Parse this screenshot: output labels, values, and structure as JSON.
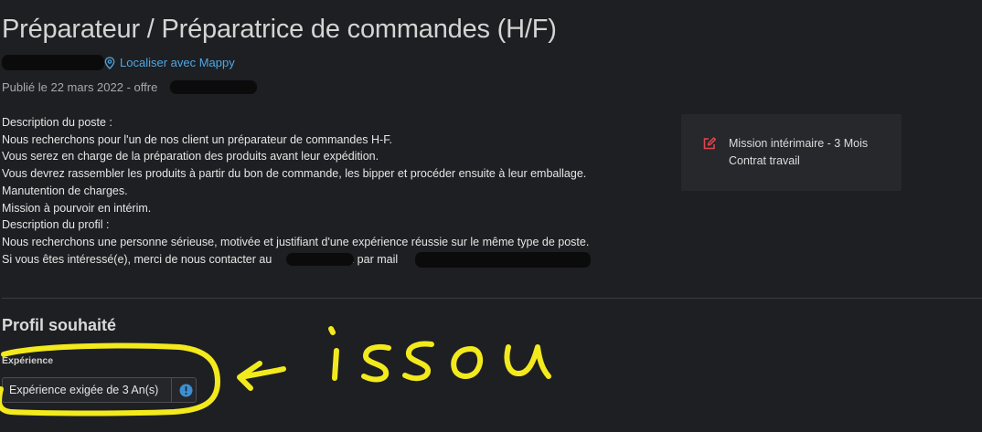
{
  "job": {
    "title": "Préparateur / Préparatrice de commandes (H/F)",
    "mappy_label": "Localiser avec Mappy",
    "published": "Publié le 22 mars 2022 - offre"
  },
  "description": {
    "lines": [
      "Description du poste :",
      "Nous recherchons pour l'un de nos client un préparateur de commandes H-F.",
      "Vous serez en charge de la préparation des produits avant leur expédition.",
      "Vous devrez rassembler les produits à partir du bon de commande, les bipper et procéder ensuite à leur emballage.",
      "Manutention de charges.",
      "Mission à pourvoir en intérim.",
      "Description du profil :",
      "Nous recherchons une personne sérieuse, motivée et justifiant d'une expérience réussie sur le même type de poste."
    ],
    "contact_prefix": "Si vous êtes intéressé(e), merci de nous contacter au",
    "contact_middle": "ou par mail"
  },
  "contract": {
    "line1": "Mission intérimaire - 3 Mois",
    "line2": "Contrat travail",
    "icon": "edit-icon",
    "icon_color": "#e0454f"
  },
  "profile": {
    "section_title": "Profil souhaité",
    "experience_label": "Expérience",
    "experience_value": "Expérience exigée de 3 An(s)",
    "info_icon_color": "#3d8fd1"
  },
  "annotation": {
    "text": "issou",
    "color": "#f2ea1c"
  },
  "colors": {
    "background": "#1e1f22",
    "link": "#4ea7e3"
  }
}
